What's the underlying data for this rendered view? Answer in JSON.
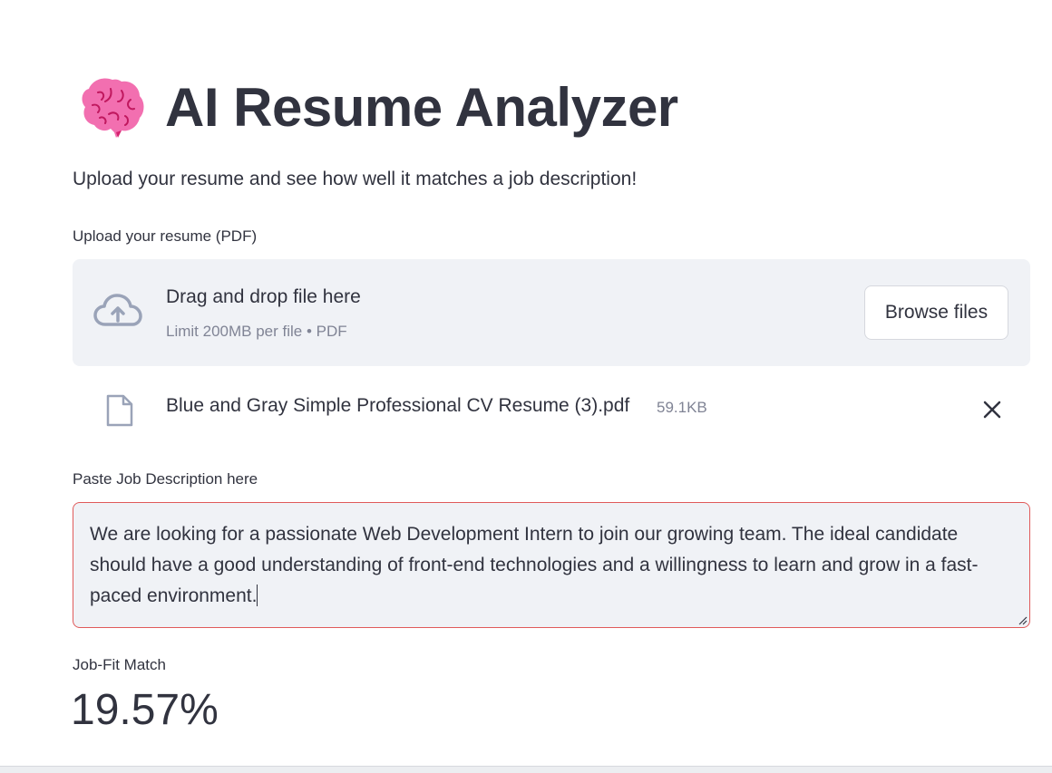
{
  "header": {
    "title": "AI Resume Analyzer",
    "icon": "brain-icon"
  },
  "subtitle": "Upload your resume and see how well it matches a job description!",
  "uploader": {
    "label": "Upload your resume (PDF)",
    "drop_title": "Drag and drop file here",
    "drop_limit": "Limit 200MB per file • PDF",
    "browse_label": "Browse files",
    "icon": "cloud-upload-icon"
  },
  "uploaded_file": {
    "name": "Blue and Gray Simple Professional CV Resume (3).pdf",
    "size": "59.1KB",
    "icon": "file-icon"
  },
  "job_description": {
    "label": "Paste Job Description here",
    "value": "We are looking for a passionate Web Development Intern to join our growing team. The ideal candidate should have a good understanding of front-end technologies and a willingness to learn and grow in a fast-paced environment."
  },
  "metric": {
    "label": "Job-Fit Match",
    "value": "19.57%"
  },
  "colors": {
    "text": "#31333f",
    "muted": "#808495",
    "panel": "#f0f2f6",
    "error_border": "#e05a5a",
    "icon_gray": "#9aa3b8",
    "brain_pink": "#f26fb0"
  }
}
